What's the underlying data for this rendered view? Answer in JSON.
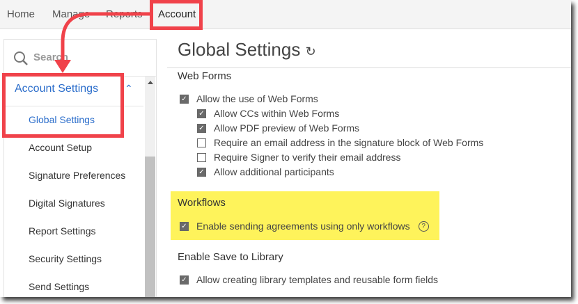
{
  "nav": {
    "items": [
      "Home",
      "Manage",
      "Reports",
      "Account"
    ]
  },
  "sidebar": {
    "search_placeholder": "Search",
    "section": "Account Settings",
    "items": [
      "Global Settings",
      "Account Setup",
      "Signature Preferences",
      "Digital Signatures",
      "Report Settings",
      "Security Settings",
      "Send Settings"
    ]
  },
  "main": {
    "title": "Global Settings",
    "web_forms": {
      "heading": "Web Forms",
      "options": [
        {
          "label": "Allow the use of Web Forms",
          "checked": true,
          "indent": 0
        },
        {
          "label": "Allow CCs within Web Forms",
          "checked": true,
          "indent": 1
        },
        {
          "label": "Allow PDF preview of Web Forms",
          "checked": true,
          "indent": 1
        },
        {
          "label": "Require an email address in the signature block of Web Forms",
          "checked": false,
          "indent": 1
        },
        {
          "label": "Require Signer to verify their email address",
          "checked": false,
          "indent": 1
        },
        {
          "label": "Allow additional participants",
          "checked": true,
          "indent": 1
        }
      ]
    },
    "workflows": {
      "heading": "Workflows",
      "option": "Enable sending agreements using only workflows"
    },
    "library": {
      "heading": "Enable Save to Library",
      "option": "Allow creating library templates and reusable form fields"
    }
  },
  "colors": {
    "highlight": "#fef35b",
    "annotation": "#f0424a",
    "link": "#2c6ecb"
  }
}
